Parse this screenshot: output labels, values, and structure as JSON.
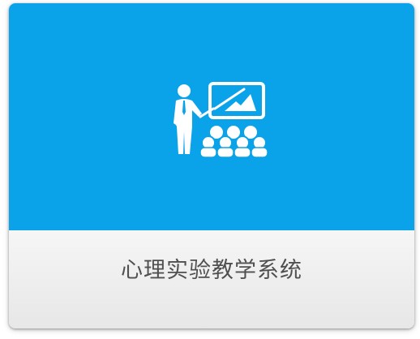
{
  "card": {
    "label": "心理实验教学系统",
    "icon": "presentation-teacher-icon",
    "colors": {
      "tile_background": "#0aa3ea",
      "icon": "#ffffff",
      "label_text": "#505050",
      "footer_background": "#eeeeee"
    }
  }
}
